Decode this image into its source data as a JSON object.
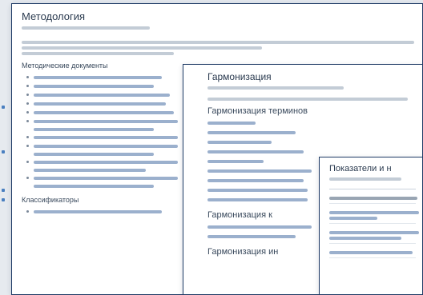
{
  "window_1": {
    "title": "Методология",
    "section_documents": "Методические документы",
    "section_classifiers": "Классификаторы"
  },
  "window_2": {
    "title": "Гармонизация",
    "section_a": "Гармонизация терминов",
    "section_b": "Гармонизация к",
    "section_c": "Гармонизация ин"
  },
  "window_3": {
    "title": "Показатели и н"
  }
}
